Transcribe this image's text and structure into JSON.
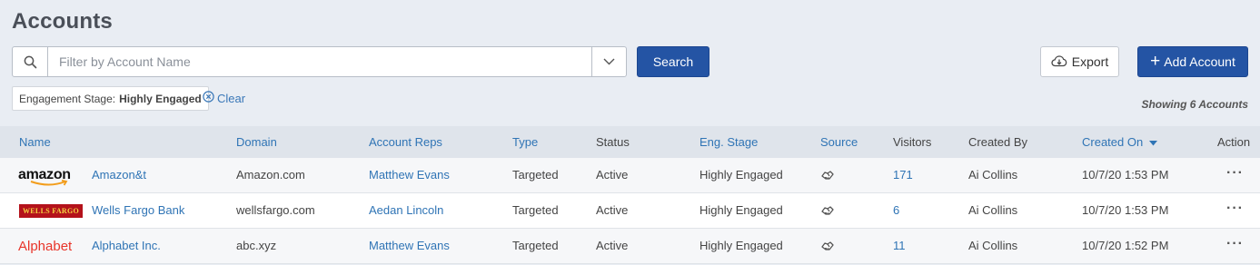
{
  "page": {
    "title": "Accounts"
  },
  "search": {
    "placeholder": "Filter by Account Name",
    "value": "",
    "button_label": "Search"
  },
  "toolbar": {
    "export_label": "Export",
    "add_label": "Add Account"
  },
  "filter": {
    "key": "Engagement Stage:",
    "value": "Highly Engaged",
    "clear_label": "Clear"
  },
  "summary": {
    "showing": "Showing 6 Accounts"
  },
  "table": {
    "headers": {
      "name": "Name",
      "domain": "Domain",
      "reps": "Account Reps",
      "type": "Type",
      "status": "Status",
      "stage": "Eng. Stage",
      "source": "Source",
      "visitors": "Visitors",
      "created_by": "Created By",
      "created_on": "Created On",
      "action": "Action"
    },
    "rows": [
      {
        "logo": "amazon",
        "logo_text": "amazon",
        "name": "Amazon&t",
        "domain": "Amazon.com",
        "rep": "Matthew Evans",
        "type": "Targeted",
        "status": "Active",
        "stage": "Highly Engaged",
        "source_icon": "handshake-icon",
        "visitors": "171",
        "created_by": "Ai Collins",
        "created_on": "10/7/20 1:53 PM"
      },
      {
        "logo": "wells",
        "logo_text": "WELLS FARGO",
        "name": "Wells Fargo Bank",
        "domain": "wellsfargo.com",
        "rep": "Aedan Lincoln",
        "type": "Targeted",
        "status": "Active",
        "stage": "Highly Engaged",
        "source_icon": "handshake-icon",
        "visitors": "6",
        "created_by": "Ai Collins",
        "created_on": "10/7/20 1:53 PM"
      },
      {
        "logo": "alphabet",
        "logo_text": "Alphabet",
        "name": "Alphabet Inc.",
        "domain": "abc.xyz",
        "rep": "Matthew Evans",
        "type": "Targeted",
        "status": "Active",
        "stage": "Highly Engaged",
        "source_icon": "handshake-icon",
        "visitors": "11",
        "created_by": "Ai Collins",
        "created_on": "10/7/20 1:52 PM"
      }
    ]
  },
  "colors": {
    "primary": "#2454a4",
    "link": "#2f74b5",
    "background": "#e9edf3",
    "header_row": "#dfe4eb"
  }
}
